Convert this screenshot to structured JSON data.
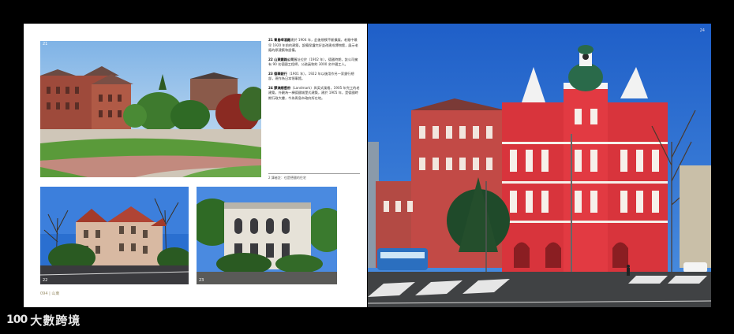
{
  "left_page": {
    "photo_top_number": "21",
    "photo_bottom_left_number": "22",
    "photo_bottom_right_number": "23",
    "captions": [
      {
        "num": "21",
        "title": "青島啤酒廠",
        "text": "建於 1904 年，此後規模不斷擴展，老廠中最早 1920 年前的建築，設備保護完好並改建成博物館，展示老廠的原建築和設備。"
      },
      {
        "num": "22",
        "title": "山東鐵路公司",
        "text": "舊址位於（1902 年），德國時期，該公司擁有 90 名德國工程師，公務員和約 3000 名中國工人。"
      },
      {
        "num": "23",
        "title": "德華銀行",
        "text": "（1901 年），1922 年以後用作另一家銀行總部，現作為日本領事館。"
      },
      {
        "num": "24",
        "title": "膠澳總督府",
        "text": "（Landmark）與英式風格，1905 年完工的老建築，外觀為一棟德國城堡式建築，建於 1905 年，是德國時期行政大樓，今為青島市政府所在地。"
      }
    ],
    "footnote": "2 譯者註：也是德國的住宅",
    "folio": "094 | 山東"
  },
  "right_page": {
    "page_number": "24"
  },
  "watermark": {
    "logo": "100",
    "text": "大數跨境"
  }
}
